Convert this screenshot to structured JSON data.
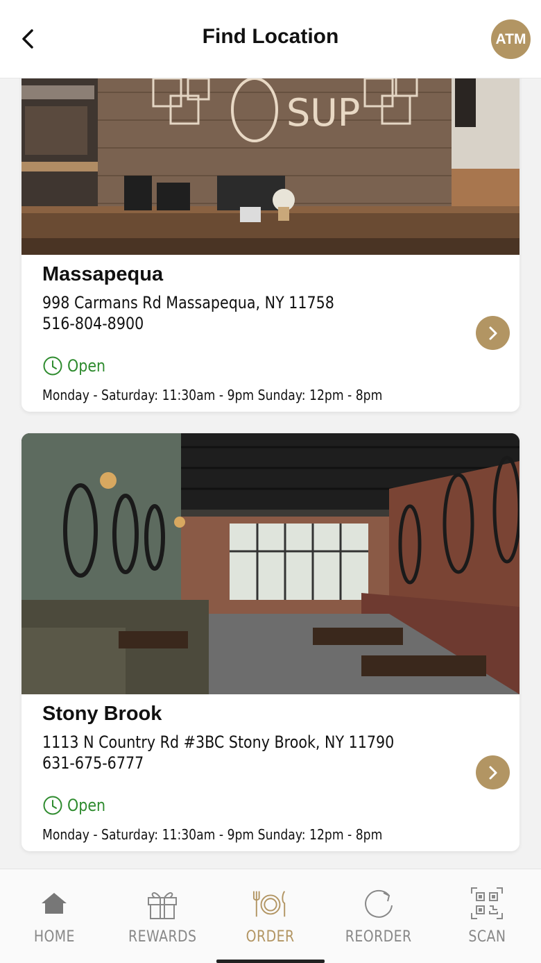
{
  "header": {
    "title": "Find Location",
    "avatar_initials": "ATM"
  },
  "locations": [
    {
      "name": "Massapequa",
      "address": "998 Carmans Rd Massapequa, NY 11758",
      "phone": "516-804-8900",
      "status": "Open",
      "hours": "Monday - Saturday: 11:30am - 9pm Sunday: 12pm - 8pm",
      "photo_sign": "SUP"
    },
    {
      "name": "Stony Brook",
      "address": "1113 N Country Rd #3BC Stony Brook, NY 11790",
      "phone": "631-675-6777",
      "status": "Open",
      "hours": "Monday - Saturday: 11:30am - 9pm Sunday: 12pm - 8pm"
    }
  ],
  "nav": {
    "items": [
      {
        "label": "HOME",
        "icon": "home-icon"
      },
      {
        "label": "REWARDS",
        "icon": "gift-icon"
      },
      {
        "label": "ORDER",
        "icon": "plate-utensils-icon"
      },
      {
        "label": "REORDER",
        "icon": "refresh-icon"
      },
      {
        "label": "SCAN",
        "icon": "qr-code-icon"
      }
    ],
    "active": "ORDER"
  },
  "colors": {
    "accent": "#b29563",
    "open_status": "#2e8b2e",
    "nav_inactive": "#888888"
  }
}
